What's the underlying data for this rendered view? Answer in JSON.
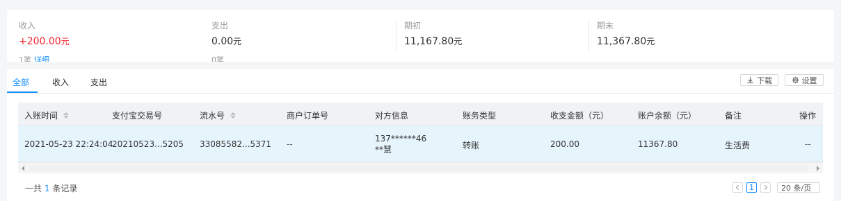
{
  "summary": {
    "income": {
      "label": "收入",
      "value": "+200.00",
      "unit": "元",
      "sub": "1笔",
      "sub_link": "详细"
    },
    "expense": {
      "label": "支出",
      "value": "0.00",
      "unit": "元",
      "sub": "0笔"
    },
    "opening": {
      "label": "期初",
      "value": "11,167.80",
      "unit": "元"
    },
    "closing": {
      "label": "期末",
      "value": "11,367.80",
      "unit": "元"
    }
  },
  "tabs": [
    {
      "label": "全部",
      "active": true
    },
    {
      "label": "收入",
      "active": false
    },
    {
      "label": "支出",
      "active": false
    }
  ],
  "toolbar": {
    "download_label": "下载",
    "download_icon": "download-icon",
    "settings_label": "设置",
    "settings_icon": "gear-icon"
  },
  "table": {
    "columns": [
      {
        "label": "入账时间",
        "sortable": true
      },
      {
        "label": "支付宝交易号",
        "sortable": false
      },
      {
        "label": "流水号",
        "sortable": true
      },
      {
        "label": "商户订单号",
        "sortable": false
      },
      {
        "label": "对方信息",
        "sortable": false
      },
      {
        "label": "账务类型",
        "sortable": false
      },
      {
        "label": "收支金额（元）",
        "sortable": false
      },
      {
        "label": "账户余额（元）",
        "sortable": false
      },
      {
        "label": "备注",
        "sortable": false
      },
      {
        "label": "操作",
        "sortable": false
      }
    ],
    "rows": [
      {
        "time": "2021-05-23 22:24:04",
        "trade_no": "20210523...5205",
        "serial_no": "33085582...5371",
        "merchant_order": "--",
        "counterparty_account": "137******46",
        "counterparty_name": "**慧",
        "type": "转账",
        "amount": "200.00",
        "balance": "11367.80",
        "remark": "生活费",
        "action": "--"
      }
    ]
  },
  "footer": {
    "total_prefix": "一共",
    "total_count": "1",
    "total_suffix": "条记录",
    "current_page": "1",
    "page_size": "20 条/页"
  },
  "colors": {
    "accent": "#1890ff",
    "income": "#f5222d",
    "row_highlight": "#e6f4fc",
    "header_bg": "#f0f2f5"
  }
}
